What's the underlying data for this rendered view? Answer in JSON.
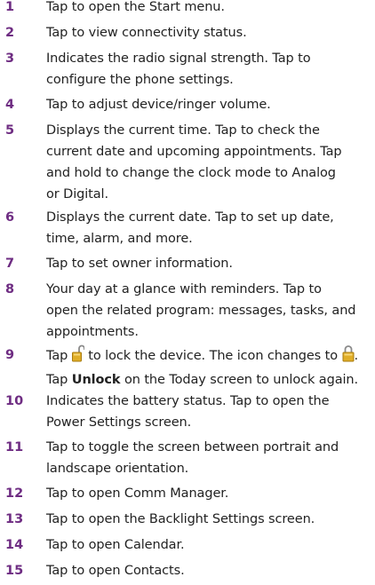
{
  "items": [
    {
      "number": "1",
      "text": "Tap to open the Start menu."
    },
    {
      "number": "2",
      "text": "Tap to view connectivity status."
    },
    {
      "number": "3",
      "text": "Indicates the radio signal strength. Tap to\nconfigure the phone settings."
    },
    {
      "number": "4",
      "text": "Tap to adjust device/ringer volume."
    },
    {
      "number": "5",
      "text": "Displays the current time. Tap to check the\ncurrent date and upcoming appointments. Tap\nand hold to change the clock mode to Analog\nor Digital."
    },
    {
      "number": "6",
      "text": "Displays the current date. Tap to set up date,\ntime, alarm, and more."
    },
    {
      "number": "7",
      "text": "Tap to set owner information."
    },
    {
      "number": "8",
      "text": "Your day at a glance with reminders. Tap to\nopen the related program: messages, tasks, and\nappointments."
    },
    {
      "number": "9",
      "part1": "Tap ",
      "part2": " to lock the device. The icon changes to ",
      "part3": ".",
      "part4": "Tap ",
      "bold": "Unlock",
      "part5": " on the Today screen to unlock again.",
      "icon_unlocked": "unlocked-padlock-icon",
      "icon_locked": "locked-padlock-icon"
    },
    {
      "number": "10",
      "text": "Indicates the battery status. Tap to open the\nPower Settings screen."
    },
    {
      "number": "11",
      "text": "Tap to toggle the screen between portrait and\nlandscape orientation."
    },
    {
      "number": "12",
      "text": "Tap to open Comm Manager."
    },
    {
      "number": "13",
      "text": "Tap to open the Backlight Settings screen."
    },
    {
      "number": "14",
      "text": "Tap to open Calendar."
    },
    {
      "number": "15",
      "text": "Tap to open Contacts."
    }
  ],
  "colors": {
    "number": "#6e2c82",
    "text": "#222222",
    "icon_gold": "#d9a520"
  }
}
